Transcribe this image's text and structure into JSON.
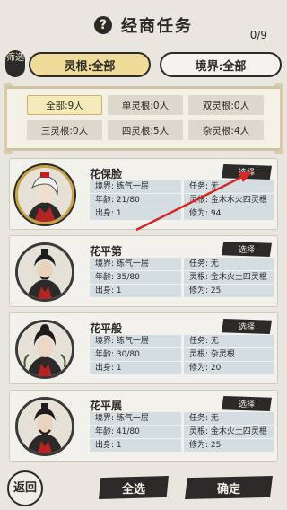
{
  "header": {
    "title": "经商任务",
    "counter": "0/9",
    "help_icon": "question-icon"
  },
  "filter": {
    "badge": "筛选",
    "spirit_root_label": "灵根:全部",
    "realm_label": "境界:全部"
  },
  "chips": [
    "全部:9人",
    "单灵根:0人",
    "双灵根:0人",
    "三灵根:0人",
    "四灵根:5人",
    "杂灵根:4人"
  ],
  "cards": [
    {
      "name": "花保脸",
      "select": "选择",
      "realm": "境界: 练气一层",
      "age": "年龄: 21/80",
      "birth": "出身: 1",
      "task": "任务: 无",
      "root": "灵根: 金木水火四灵根",
      "power": "修为: 94"
    },
    {
      "name": "花平第",
      "select": "选择",
      "realm": "境界: 练气一层",
      "age": "年龄: 35/80",
      "birth": "出身: 1",
      "task": "任务: 无",
      "root": "灵根: 金木火土四灵根",
      "power": "修为: 25"
    },
    {
      "name": "花平般",
      "select": "选择",
      "realm": "境界: 练气一层",
      "age": "年龄: 30/80",
      "birth": "出身: 1",
      "task": "任务: 无",
      "root": "灵根: 杂灵根",
      "power": "修为: 20"
    },
    {
      "name": "花平展",
      "select": "选择",
      "realm": "境界: 练气一层",
      "age": "年龄: 41/80",
      "birth": "出身: 1",
      "task": "任务: 无",
      "root": "灵根: 金木火土四灵根",
      "power": "修为: 25"
    }
  ],
  "footer": {
    "back": "返回",
    "select_all": "全选",
    "confirm": "确定"
  },
  "colors": {
    "accent": "#f0dc9a",
    "dark": "#2b2a28",
    "field": "#d4dee2",
    "arrow": "#d62828"
  }
}
